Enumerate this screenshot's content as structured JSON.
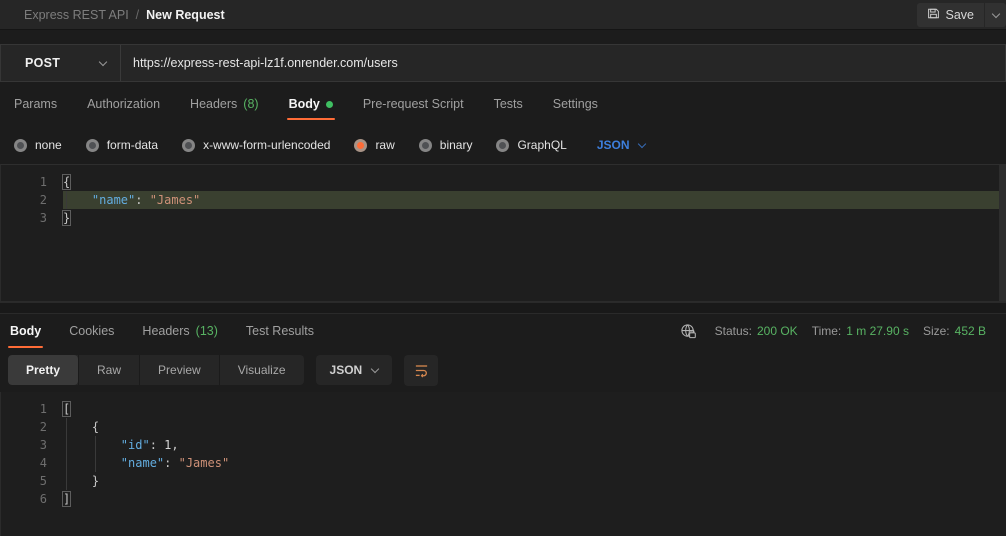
{
  "colors": {
    "accent_orange": "#ff6c37",
    "success_green": "#58b363",
    "dot_green": "#3fbf62",
    "link_blue": "#3d7fdd",
    "key_blue": "#63ade0",
    "string_orange": "#ce9178"
  },
  "header": {
    "breadcrumb": {
      "project": "Express REST API",
      "separator": "/",
      "current": "New Request"
    },
    "save_label": "Save"
  },
  "request": {
    "method": "POST",
    "url": "https://express-rest-api-lz1f.onrender.com/users",
    "tabs": [
      {
        "label": "Params"
      },
      {
        "label": "Authorization"
      },
      {
        "label": "Headers",
        "count": "(8)"
      },
      {
        "label": "Body",
        "active": true,
        "dot": true
      },
      {
        "label": "Pre-request Script"
      },
      {
        "label": "Tests"
      },
      {
        "label": "Settings"
      }
    ],
    "body_modes": [
      {
        "label": "none"
      },
      {
        "label": "form-data"
      },
      {
        "label": "x-www-form-urlencoded"
      },
      {
        "label": "raw",
        "selected": true
      },
      {
        "label": "binary"
      },
      {
        "label": "GraphQL"
      }
    ],
    "raw_language": "JSON",
    "editor_lines": [
      {
        "num": "1",
        "indent": 0,
        "tokens": [
          {
            "cls": "bracket",
            "v": "{"
          }
        ]
      },
      {
        "num": "2",
        "indent": 1,
        "highlight": true,
        "tokens": [
          {
            "cls": "key",
            "v": "\"name\""
          },
          {
            "cls": "punc",
            "v": ": "
          },
          {
            "cls": "str",
            "v": "\"James\""
          }
        ]
      },
      {
        "num": "3",
        "indent": 0,
        "tokens": [
          {
            "cls": "bracket",
            "v": "}"
          }
        ]
      }
    ]
  },
  "response": {
    "tabs": [
      {
        "label": "Body",
        "active": true
      },
      {
        "label": "Cookies"
      },
      {
        "label": "Headers",
        "count": "(13)"
      },
      {
        "label": "Test Results"
      }
    ],
    "meta": {
      "status_label": "Status:",
      "status_value": "200 OK",
      "time_label": "Time:",
      "time_value": "1 m 27.90 s",
      "size_label": "Size:",
      "size_value": "452 B"
    },
    "views": [
      {
        "label": "Pretty",
        "active": true
      },
      {
        "label": "Raw"
      },
      {
        "label": "Preview"
      },
      {
        "label": "Visualize"
      }
    ],
    "language": "JSON",
    "editor_lines": [
      {
        "num": "1",
        "indent": 0,
        "tokens": [
          {
            "cls": "bracket",
            "v": "["
          }
        ]
      },
      {
        "num": "2",
        "indent": 1,
        "tokens": [
          {
            "cls": "punc",
            "v": "{"
          }
        ]
      },
      {
        "num": "3",
        "indent": 2,
        "tokens": [
          {
            "cls": "key",
            "v": "\"id\""
          },
          {
            "cls": "punc",
            "v": ": "
          },
          {
            "cls": "num",
            "v": "1"
          },
          {
            "cls": "punc",
            "v": ","
          }
        ]
      },
      {
        "num": "4",
        "indent": 2,
        "tokens": [
          {
            "cls": "key",
            "v": "\"name\""
          },
          {
            "cls": "punc",
            "v": ": "
          },
          {
            "cls": "str",
            "v": "\"James\""
          }
        ]
      },
      {
        "num": "5",
        "indent": 1,
        "tokens": [
          {
            "cls": "punc",
            "v": "}"
          }
        ]
      },
      {
        "num": "6",
        "indent": 0,
        "tokens": [
          {
            "cls": "bracket",
            "v": "]"
          }
        ]
      }
    ]
  }
}
